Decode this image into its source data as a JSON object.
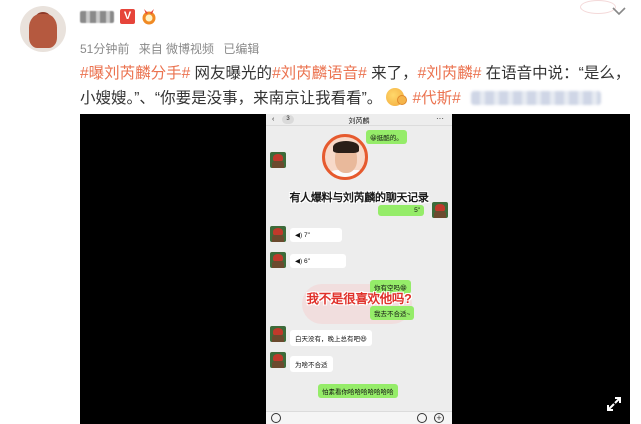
{
  "post": {
    "meta_time": "51分钟前",
    "meta_source": "来自 微博视频",
    "meta_edited": "已编辑",
    "vip_badge": "V",
    "content": [
      {
        "type": "tag",
        "text": "#曝刘芮麟分手#"
      },
      {
        "type": "plain",
        "text": " 网友曝光的"
      },
      {
        "type": "tag",
        "text": "#刘芮麟语音#"
      },
      {
        "type": "plain",
        "text": " 来了，"
      },
      {
        "type": "tag",
        "text": "#刘芮麟#"
      },
      {
        "type": "plain",
        "text": " 在语音中说：“是么，小嫂嫂。”、“你要是没事，来南京让我看看”。"
      },
      {
        "type": "emoji",
        "name": "heart-eyes-emoji"
      },
      {
        "type": "tag",
        "text": " #代斯#"
      }
    ]
  },
  "video": {
    "phone": {
      "back_count": "3",
      "title": "刘芮麟",
      "more": "···",
      "caption_top": "有人爆料与刘芮麟的聊天记录",
      "caption_mid": "我不是很喜欢他吗?",
      "messages": [
        {
          "side": "right",
          "text": "😀挺酷的。"
        },
        {
          "side": "right",
          "text": "5\""
        },
        {
          "side": "left",
          "text": "◀) 7\""
        },
        {
          "side": "left",
          "text": "◀) 6\""
        },
        {
          "side": "right",
          "text": "你有空吗😁"
        },
        {
          "side": "right",
          "text": "我去不合适~"
        },
        {
          "side": "left",
          "text": "白天没有，晚上总有吧😆"
        },
        {
          "side": "left",
          "text": "为啥不合适"
        },
        {
          "side": "right",
          "text": "怕素看你哈哈哈哈哈哈哈"
        }
      ]
    }
  },
  "colors": {
    "tag": "#eb7350",
    "meta": "#8a8a8a",
    "bubble_green": "#95ec69",
    "caption_red": "#e0312b",
    "vip_red": "#e6443a"
  }
}
